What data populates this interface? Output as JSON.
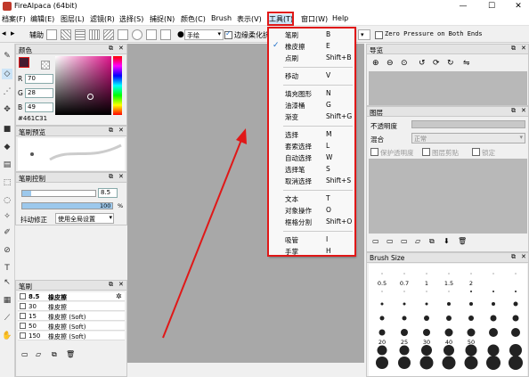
{
  "window": {
    "title": "FireAlpaca (64bit)",
    "controls": [
      "—",
      "☐",
      "✕"
    ]
  },
  "menubar": {
    "items": [
      "档案(F)",
      "编辑(E)",
      "图层(L)",
      "滤镜(R)",
      "选择(S)",
      "捕捉(N)",
      "颜色(C)",
      "Brush",
      "表示(V)",
      "工具(T)",
      "窗口(W)",
      "Help"
    ]
  },
  "toolbar": {
    "aux_label": "辅助",
    "handdraw_select": "手绘",
    "edge_soften_label": "边缘柔化抗",
    "zero_pressure_label": "Zero Pressure on Both Ends"
  },
  "color_panel": {
    "title": "颜色",
    "r_label": "R",
    "r_value": "70",
    "g_label": "G",
    "g_value": "28",
    "b_label": "B",
    "b_value": "49",
    "hex": "#461C31",
    "main_color": "#461C31"
  },
  "brush_preview_panel": {
    "title": "笔刷预览"
  },
  "brush_control_panel": {
    "title": "笔刷控制",
    "size_value": "8.5",
    "opacity_value": "100",
    "opacity_unit": "%",
    "stabilizer_label": "抖动修正",
    "global_setting": "使用全局设置"
  },
  "brush_panel": {
    "title": "笔刷",
    "items": [
      {
        "size": "8.5",
        "name": "橡皮擦",
        "selected": true
      },
      {
        "size": "30",
        "name": "橡皮擦",
        "selected": false
      },
      {
        "size": "15",
        "name": "橡皮擦 (Soft)",
        "selected": false
      },
      {
        "size": "50",
        "name": "橡皮擦 (Soft)",
        "selected": false
      },
      {
        "size": "150",
        "name": "橡皮擦 (Soft)",
        "selected": false
      }
    ]
  },
  "tools_menu": {
    "groups": [
      [
        {
          "label": "笔刷",
          "shortcut": "B",
          "checked": false
        },
        {
          "label": "橡皮擦",
          "shortcut": "E",
          "checked": true
        },
        {
          "label": "点刷",
          "shortcut": "Shift+B",
          "checked": false
        }
      ],
      [
        {
          "label": "移动",
          "shortcut": "V",
          "checked": false
        }
      ],
      [
        {
          "label": "填充图形",
          "shortcut": "N",
          "checked": false
        },
        {
          "label": "油漆桶",
          "shortcut": "G",
          "checked": false
        },
        {
          "label": "渐变",
          "shortcut": "Shift+G",
          "checked": false
        }
      ],
      [
        {
          "label": "选择",
          "shortcut": "M",
          "checked": false
        },
        {
          "label": "套索选择",
          "shortcut": "L",
          "checked": false
        },
        {
          "label": "自动选择",
          "shortcut": "W",
          "checked": false
        },
        {
          "label": "选择笔",
          "shortcut": "S",
          "checked": false
        },
        {
          "label": "取消选择",
          "shortcut": "Shift+S",
          "checked": false
        }
      ],
      [
        {
          "label": "文本",
          "shortcut": "T",
          "checked": false
        },
        {
          "label": "对象操作",
          "shortcut": "O",
          "checked": false
        },
        {
          "label": "框格分割",
          "shortcut": "Shift+O",
          "checked": false
        }
      ],
      [
        {
          "label": "吸管",
          "shortcut": "I",
          "checked": false
        },
        {
          "label": "手掌",
          "shortcut": "H",
          "checked": false
        }
      ]
    ]
  },
  "navigator_panel": {
    "title": "导览"
  },
  "layer_panel": {
    "title": "图层",
    "opacity_label": "不透明度",
    "blend_label": "混合",
    "blend_value": "正常",
    "protect_alpha": "保护透明度",
    "clipping": "图层剪贴",
    "lock": "锁定"
  },
  "brush_size_panel": {
    "title": "Brush Size",
    "labels": [
      "0.5",
      "0.7",
      "1",
      "1.5",
      "2",
      "",
      "",
      "",
      "",
      "",
      "",
      "",
      "",
      "",
      "",
      "20",
      "25",
      "30",
      "40",
      "50",
      "",
      "",
      "",
      "",
      "",
      ""
    ]
  },
  "colors": {
    "highlight_red": "#e01818",
    "check_blue": "#1e6fc8",
    "canvas_bg": "#a8a8a8"
  }
}
